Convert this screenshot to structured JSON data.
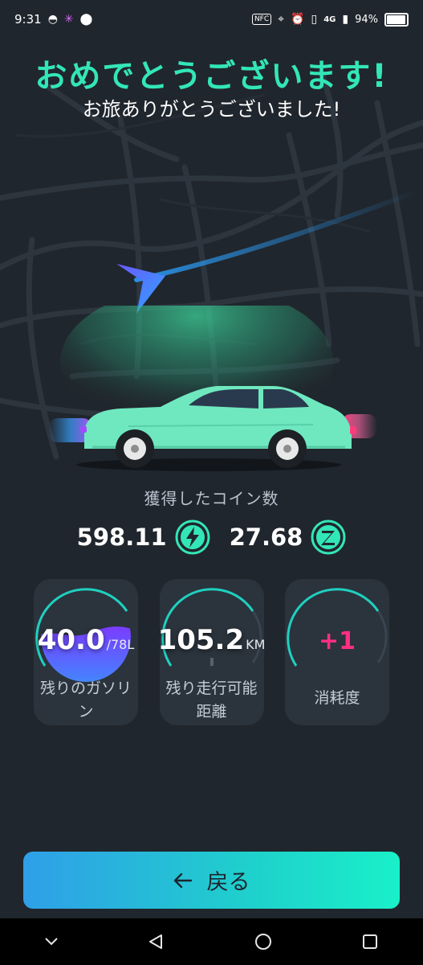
{
  "status_bar": {
    "time": "9:31",
    "nfc": "NFC",
    "network": "4G",
    "battery": "94%"
  },
  "header": {
    "title": "おめでとうございます!",
    "subtitle": "お旅ありがとうございました!"
  },
  "coins": {
    "label": "獲得したコイン数",
    "items": [
      {
        "value": "598.11",
        "icon": "lightning-coin-icon"
      },
      {
        "value": "27.68",
        "icon": "z-coin-icon"
      }
    ]
  },
  "stats": [
    {
      "value": "40.0",
      "unit": "/78L",
      "label": "残りのガソリン",
      "fill_percent": 51
    },
    {
      "value": "105.2",
      "unit": "KM",
      "label": "残り走行可能距離"
    },
    {
      "value": "+1",
      "label": "消耗度"
    }
  ],
  "back_button": {
    "label": "戻る",
    "icon": "arrow-left-icon"
  },
  "nav": [
    "chevron-down-icon",
    "back-triangle-icon",
    "home-circle-icon",
    "recents-square-icon"
  ],
  "colors": {
    "accent": "#33e6b8",
    "background": "#20262d",
    "card": "#2b333c",
    "pink": "#ff2e83",
    "button_start": "#2f9fe8",
    "button_end": "#19f0c9"
  }
}
